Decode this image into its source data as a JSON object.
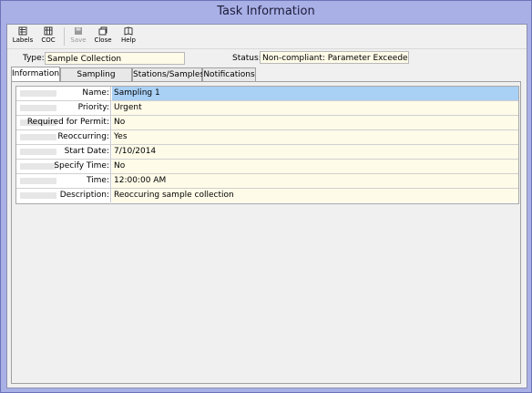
{
  "window": {
    "title": "Task Information"
  },
  "toolbar": {
    "buttons": [
      {
        "label": "Labels",
        "icon": "labels-icon",
        "enabled": true
      },
      {
        "label": "COC",
        "icon": "coc-icon",
        "enabled": true
      },
      {
        "label": "Save",
        "icon": "save-icon",
        "enabled": false
      },
      {
        "label": "Close",
        "icon": "close-icon",
        "enabled": true
      },
      {
        "label": "Help",
        "icon": "help-icon",
        "enabled": true
      }
    ]
  },
  "header": {
    "type_label": "Type:",
    "type_value": "Sample Collection",
    "status_label": "Status:",
    "status_value": "Non-compliant: Parameter Exceedence"
  },
  "tabs": [
    {
      "label": "Information",
      "active": true
    },
    {
      "label": "Sampling Defaults",
      "active": false
    },
    {
      "label": "Stations/Samples",
      "active": false
    },
    {
      "label": "Notifications",
      "active": false
    }
  ],
  "info": {
    "rows": [
      {
        "label": "Name:",
        "value": "Sampling 1",
        "selected": true
      },
      {
        "label": "Priority:",
        "value": "Urgent"
      },
      {
        "label": "Required for Permit:",
        "value": "No"
      },
      {
        "label": "Reoccurring:",
        "value": "Yes"
      },
      {
        "label": "Start Date:",
        "value": "7/10/2014"
      },
      {
        "label": "Specify Time:",
        "value": "No"
      },
      {
        "label": "Time:",
        "value": "12:00:00 AM"
      },
      {
        "label": "Description:",
        "value": "Reoccuring sample collection"
      }
    ]
  },
  "colors": {
    "title_bar": "#a9b0e6",
    "field_background": "#fefbe8",
    "selection": "#a9d0f5"
  }
}
